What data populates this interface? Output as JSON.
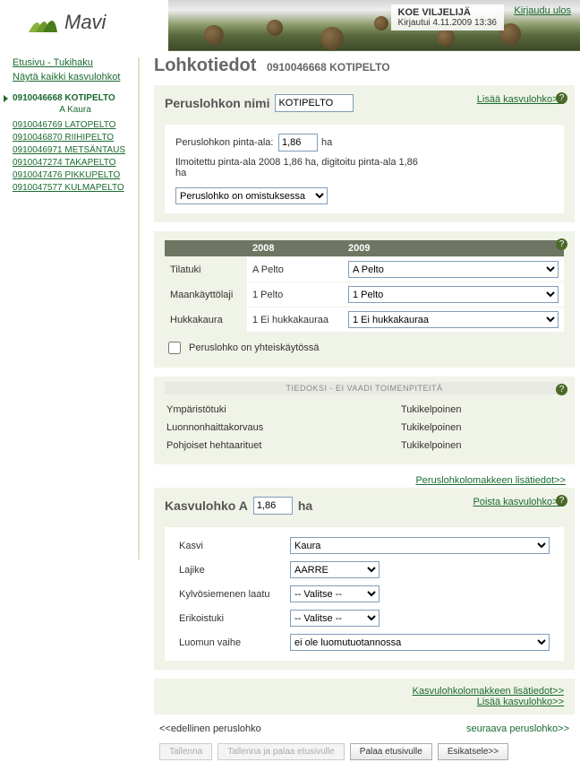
{
  "header": {
    "brand": "Mavi",
    "user_name": "KOE VILJELIJÄ",
    "login_info": "Kirjautui 4.11.2009 13:36",
    "logout": "Kirjaudu ulos"
  },
  "sidebar": {
    "home_link": "Etusivu - Tukihaku",
    "show_all": "Näytä kaikki kasvulohkot",
    "current": {
      "code": "0910046668 KOTIPELTO",
      "sub": "A Kaura"
    },
    "others": [
      "0910046769 LATOPELTO",
      "0910046870 RIIHIPELTO",
      "0910046971 METSÄNTAUS",
      "0910047274 TAKAPELTO",
      "0910047476 PIKKUPELTO",
      "0910047577 KULMAPELTO"
    ]
  },
  "page": {
    "title": "Lohkotiedot",
    "subtitle": "0910046668 KOTIPELTO"
  },
  "basic": {
    "section": "Peruslohkon nimi",
    "name_value": "KOTIPELTO",
    "add_link": "Lisää kasvulohko>>",
    "area_label": "Peruslohkon pinta-ala:",
    "area_value": "1,86",
    "area_unit": "ha",
    "reported": "Ilmoitettu pinta-ala 2008 1,86 ha, digitoitu pinta-ala 1,86 ha",
    "ownership": "Peruslohko on omistuksessa"
  },
  "years": {
    "y1": "2008",
    "y2": "2009",
    "rows": [
      {
        "label": "Tilatuki",
        "v2008": "A Pelto",
        "v2009": "A Pelto"
      },
      {
        "label": "Maankäyttölaji",
        "v2008": "1 Pelto",
        "v2009": "1 Pelto"
      },
      {
        "label": "Hukkakaura",
        "v2008": "1 Ei hukkakauraa",
        "v2009": "1 Ei hukkakauraa"
      }
    ],
    "shared_label": "Peruslohko on yhteiskäytössä"
  },
  "info": {
    "banner": "TIEDOKSI - EI VAADI TOIMENPITEITÄ",
    "rows": [
      {
        "k": "Ympäristötuki",
        "v": "Tukikelpoinen"
      },
      {
        "k": "Luonnonhaittakorvaus",
        "v": "Tukikelpoinen"
      },
      {
        "k": "Pohjoiset hehtaarituet",
        "v": "Tukikelpoinen"
      }
    ],
    "more_link": "Peruslohkolomakkeen lisätiedot>>"
  },
  "grow": {
    "title": "Kasvulohko A",
    "area": "1,86",
    "unit": "ha",
    "remove": "Poista kasvulohko>>",
    "rows": {
      "kasvi_label": "Kasvi",
      "kasvi": "Kaura",
      "lajike_label": "Lajike",
      "lajike": "AARRE",
      "siemen_label": "Kylvösiemenen laatu",
      "siemen": "-- Valitse --",
      "erikois_label": "Erikoistuki",
      "erikois": "-- Valitse --",
      "luomu_label": "Luomun vaihe",
      "luomu": "ei ole luomutuotannossa"
    }
  },
  "footer_links": {
    "more": "Kasvulohkolomakkeen lisätiedot>>",
    "add": "Lisää kasvulohko>>"
  },
  "pager": {
    "prev": "<<edellinen peruslohko",
    "next": "seuraava peruslohko>>"
  },
  "buttons": {
    "save": "Tallenna",
    "save_home": "Tallenna ja palaa etusivulle",
    "home": "Palaa etusivulle",
    "preview": "Esikatsele>>"
  }
}
